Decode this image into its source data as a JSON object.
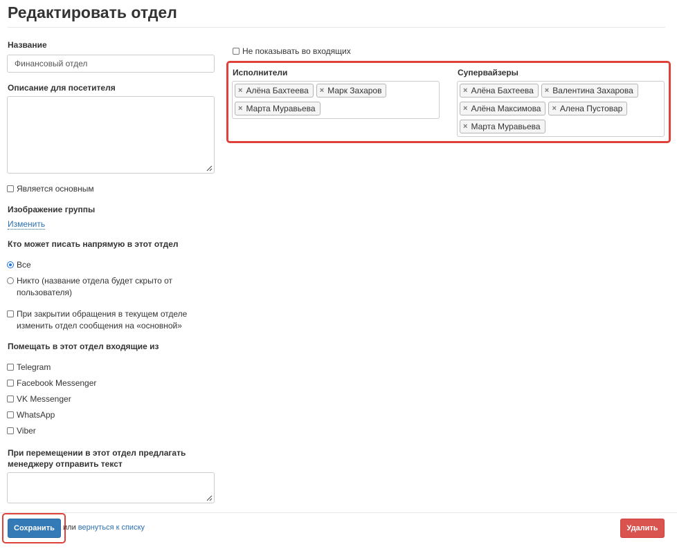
{
  "page": {
    "title": "Редактировать отдел"
  },
  "form": {
    "name_label": "Название",
    "name_value": "Финансовый отдел",
    "description_label": "Описание для посетителя",
    "description_value": "",
    "is_main_label": "Является основным",
    "image_label": "Изображение группы",
    "image_change_link": "Изменить",
    "who_can_write_label": "Кто может писать напрямую в этот отдел",
    "radio_all": "Все",
    "radio_nobody_line1": "Никто (название отдела будет скрыто от",
    "radio_nobody_line2": "пользователя)",
    "on_close_line1": "При закрытии обращения в текущем отделе",
    "on_close_line2": "изменить отдел сообщения на «основной»",
    "incoming_label": "Помещать в этот отдел входящие из",
    "channels": [
      "Telegram",
      "Facebook Messenger",
      "VK Messenger",
      "WhatsApp",
      "Viber"
    ],
    "move_text_label_line1": "При перемещении в этот отдел предлагать",
    "move_text_label_line2": "менеджеру отправить текст",
    "move_text_value": ""
  },
  "right": {
    "hide_incoming_label": "Не показывать во входящих",
    "executors_label": "Исполнители",
    "executors": [
      "Алёна Бахтеева",
      "Марк Захаров",
      "Марта Муравьева"
    ],
    "supervisors_label": "Супервайзеры",
    "supervisors": [
      "Алёна Бахтеева",
      "Валентина Захарова",
      "Алёна Максимова",
      "Алена Пустовар",
      "Марта Муравьева"
    ]
  },
  "footer": {
    "save_label": "Сохранить",
    "or_text": "или",
    "back_link": "вернуться к списку",
    "delete_label": "Удалить"
  },
  "colors": {
    "primary": "#337ab7",
    "danger": "#d9534f",
    "highlight": "#e0403a",
    "link": "#2a6fb0"
  }
}
